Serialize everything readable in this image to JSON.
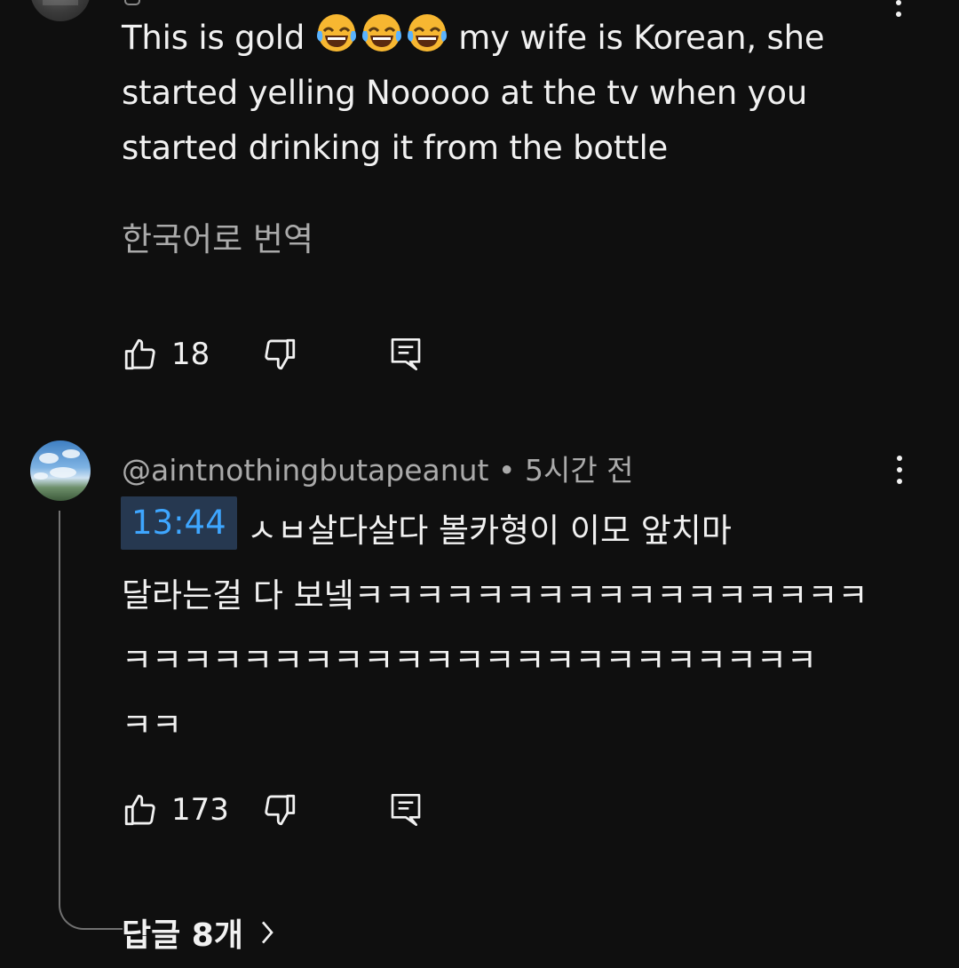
{
  "top_comment": {
    "text_lines": [
      {
        "before": "This is gold ",
        "after": " my wife is Korean, she"
      },
      "started yelling Nooooo at the tv when you",
      "started drinking it from the bottle"
    ],
    "emoji_icon": "face-with-tears-of-joy",
    "translate_label": "한국어로 번역",
    "like_count": "18"
  },
  "reply_comment": {
    "handle": "@aintnothingbutapeanut",
    "separator": "•",
    "time_ago": "5시간 전",
    "timestamp": "13:44",
    "line1_after_timestamp": "ㅅㅂ살다살다 볼카형이 이모 앞치마",
    "line2": "달라는걸 다 보넼ㅋㅋㅋㅋㅋㅋㅋㅋㅋㅋㅋㅋㅋㅋㅋㅋㅋ",
    "line3": "ㅋㅋㅋㅋㅋㅋㅋㅋㅋㅋㅋㅋㅋㅋㅋㅋㅋㅋㅋㅋㅋㅋㅋ",
    "line4": "ㅋㅋ",
    "like_count": "173",
    "replies_label": "답글 8개"
  },
  "colors": {
    "background": "#0f0f0f",
    "primary_text": "#f1f1f1",
    "secondary_text": "#aaaaaa",
    "timestamp_text": "#3ea6ff",
    "timestamp_bg": "#263850"
  },
  "icons": [
    "thumbs-up-icon",
    "thumbs-down-icon",
    "reply-icon",
    "more-vert-icon",
    "chevron-right-icon"
  ]
}
